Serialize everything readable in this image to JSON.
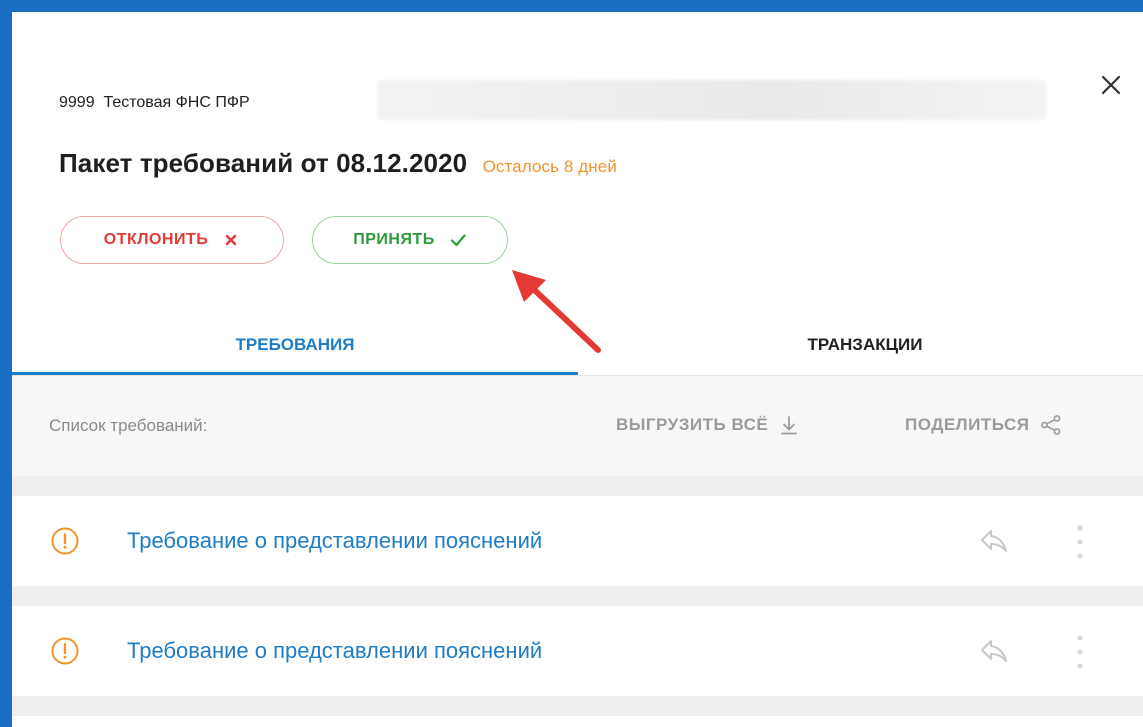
{
  "header": {
    "org_code": "9999",
    "org_name": "Тестовая ФНС ПФР",
    "title": "Пакет требований от 08.12.2020",
    "deadline": "Осталось 8 дней"
  },
  "actions": {
    "reject_label": "ОТКЛОНИТЬ",
    "accept_label": "ПРИНЯТЬ"
  },
  "tabs": [
    {
      "label": "ТРЕБОВАНИЯ",
      "active": true
    },
    {
      "label": "ТРАНЗАКЦИИ",
      "active": false
    }
  ],
  "toolbar": {
    "list_label": "Список требований:",
    "export_label": "ВЫГРУЗИТЬ ВСЁ",
    "share_label": "ПОДЕЛИТЬСЯ"
  },
  "requirements": [
    {
      "title": "Требование о представлении пояснений",
      "status_icon": "warning-icon"
    },
    {
      "title": "Требование о представлении пояснений",
      "status_icon": "warning-icon"
    }
  ],
  "colors": {
    "accent": "#1f7cc7",
    "reject": "#e53935",
    "accept": "#2e9a3a",
    "warning": "#f5922a",
    "annotation_arrow": "#e53935"
  }
}
